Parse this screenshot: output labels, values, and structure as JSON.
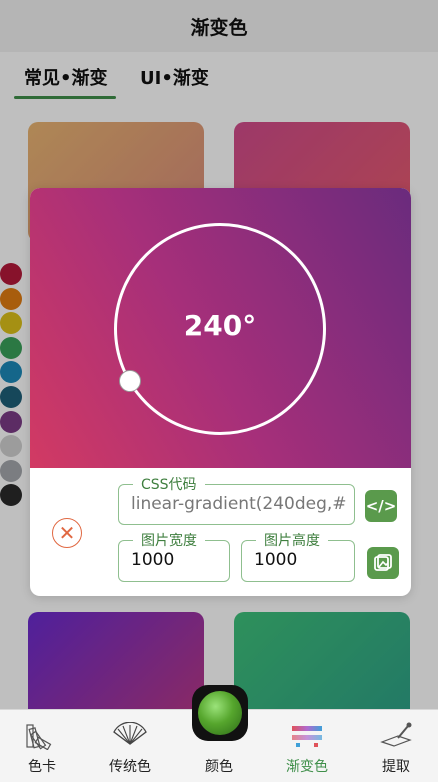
{
  "header": {
    "title": "渐变色"
  },
  "tabs": [
    {
      "label": "常见•渐变"
    },
    {
      "label": "UI•渐变"
    }
  ],
  "colors": {
    "accent": "#3f8f4a",
    "swatches": [
      "#b5183a",
      "#e07c12",
      "#dcc11a",
      "#3aa05a",
      "#1d88b8",
      "#1e5f78",
      "#7b3b86",
      "#d0d0d0",
      "#a4a7ad",
      "#2a2a2a"
    ]
  },
  "modal": {
    "angle_text": "240°",
    "css_legend": "CSS代码",
    "css_value": "linear-gradient(240deg,#",
    "width_legend": "图片宽度",
    "width_value": "1000",
    "height_legend": "图片高度",
    "height_value": "1000",
    "icons": {
      "close": "close-circle-icon",
      "code": "code-icon",
      "image": "image-export-icon"
    }
  },
  "bottom_nav": [
    {
      "label": "色卡",
      "icon": "color-card-icon"
    },
    {
      "label": "传统色",
      "icon": "fan-icon"
    },
    {
      "label": "颜色",
      "icon": "color-ball-icon"
    },
    {
      "label": "渐变色",
      "icon": "gradient-icon",
      "active": true
    },
    {
      "label": "提取",
      "icon": "picker-icon"
    }
  ]
}
